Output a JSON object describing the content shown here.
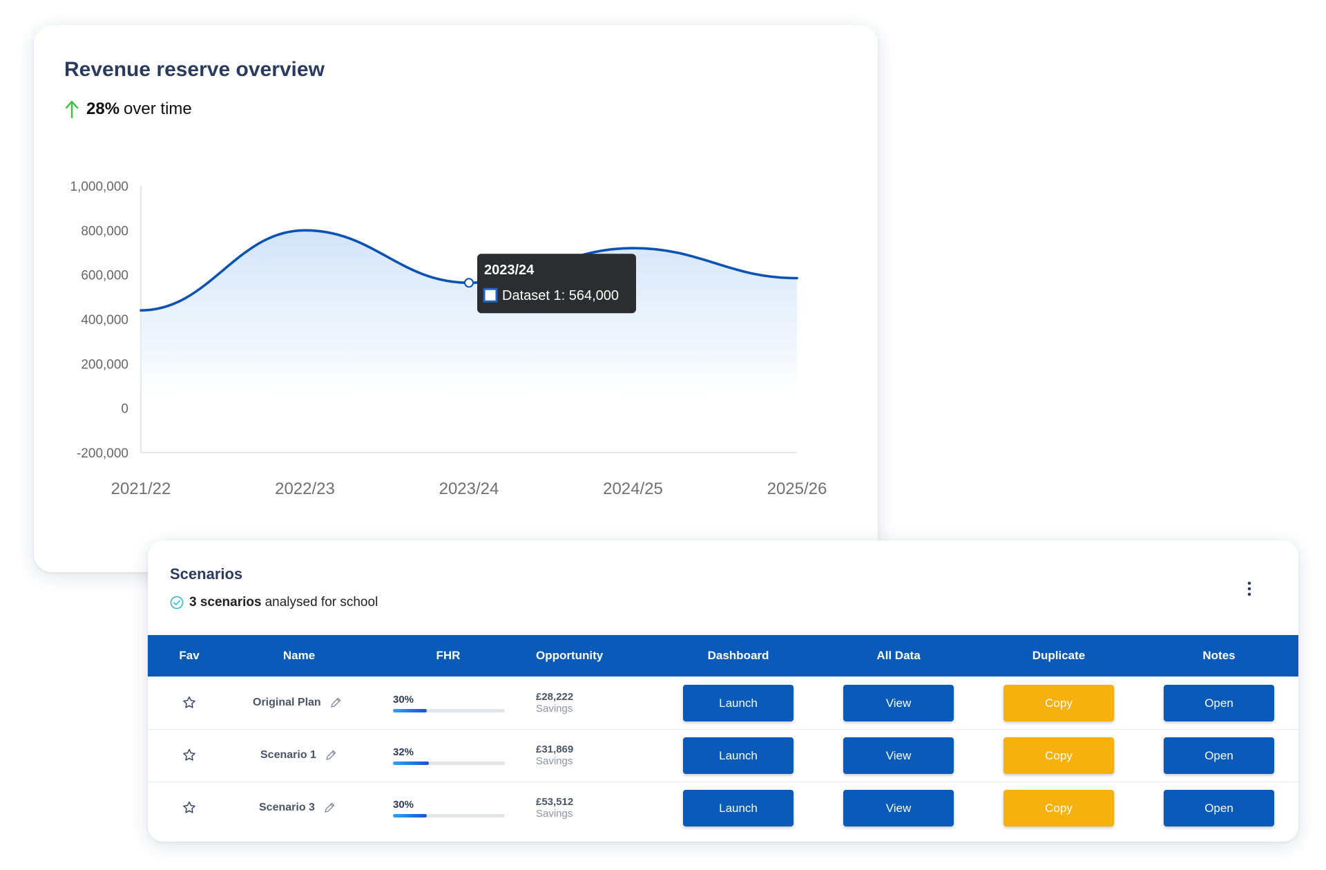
{
  "overview": {
    "title": "Revenue reserve overview",
    "trend_value": "28%",
    "trend_text": "over time",
    "trend_color": "#3cc23c"
  },
  "chart_data": {
    "type": "area",
    "x": [
      "2021/22",
      "2022/23",
      "2023/24",
      "2024/25",
      "2025/26"
    ],
    "series": [
      {
        "name": "Dataset 1",
        "values": [
          440000,
          800000,
          564000,
          720000,
          585000
        ],
        "color": "#0a52b5"
      }
    ],
    "ylim": [
      -200000,
      1000000
    ],
    "yticks": [
      "1,000,000",
      "800,000",
      "600,000",
      "400,000",
      "200,000",
      "0",
      "-200,000"
    ],
    "ytick_values": [
      1000000,
      800000,
      600000,
      400000,
      200000,
      0,
      -200000
    ],
    "tooltip": {
      "title": "2023/24",
      "label": "Dataset 1: 564,000",
      "index": 2
    },
    "grid": false,
    "legend": "none"
  },
  "scenarios": {
    "title": "Scenarios",
    "count_bold": "3 scenarios",
    "count_rest": "analysed for school",
    "menu_icon": "kebab-menu-icon",
    "columns": [
      "Fav",
      "Name",
      "FHR",
      "Opportunity",
      "Dashboard",
      "All Data",
      "Duplicate",
      "Notes"
    ],
    "rows": [
      {
        "name": "Original Plan",
        "fhr": "30%",
        "fhr_level": 0.3,
        "opportunity": "£28,222",
        "opportunity_label": "Savings",
        "dashboard": "Launch",
        "all_data": "View",
        "duplicate": "Copy",
        "notes": "Open"
      },
      {
        "name": "Scenario 1",
        "fhr": "32%",
        "fhr_level": 0.32,
        "opportunity": "£31,869",
        "opportunity_label": "Savings",
        "dashboard": "Launch",
        "all_data": "View",
        "duplicate": "Copy",
        "notes": "Open"
      },
      {
        "name": "Scenario 3",
        "fhr": "30%",
        "fhr_level": 0.3,
        "opportunity": "£53,512",
        "opportunity_label": "Savings",
        "dashboard": "Launch",
        "all_data": "View",
        "duplicate": "Copy",
        "notes": "Open"
      }
    ]
  },
  "colors": {
    "primary": "#0a5ab9",
    "accent": "#f6b10f",
    "heading": "#2a3b5f"
  }
}
